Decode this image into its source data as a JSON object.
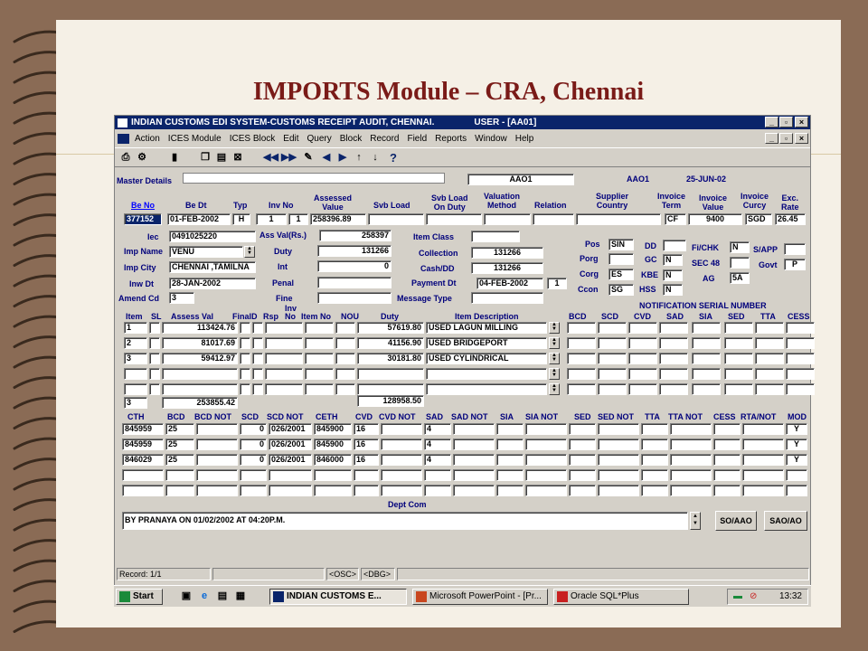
{
  "slide": {
    "title": "IMPORTS Module – CRA, Chennai"
  },
  "window": {
    "title": "INDIAN CUSTOMS EDI SYSTEM-CUSTOMS RECEIPT AUDIT, CHENNAI.",
    "user": "USER - [AA01]"
  },
  "menu": [
    "Action",
    "ICES Module",
    "ICES Block",
    "Edit",
    "Query",
    "Block",
    "Record",
    "Field",
    "Reports",
    "Window",
    "Help"
  ],
  "master": {
    "label": "Master Details",
    "user_code": "AAO1",
    "user_code2": "AAO1",
    "date": "25-JUN-02"
  },
  "hdr1": {
    "be_no": "Be No",
    "be_dt": "Be Dt",
    "typ": "Typ",
    "inv_no": "Inv No",
    "assessed_value": "Assessed\nValue",
    "svb_load": "Svb Load",
    "svb_load_on_duty": "Svb Load\nOn Duty",
    "valuation_method": "Valuation\nMethod",
    "relation": "Relation",
    "supplier_country": "Supplier\nCountry",
    "invoice_term": "Invoice\nTerm",
    "invoice_value": "Invoice\nValue",
    "invoice_curcy": "Invoice\nCurcy",
    "exc_rate": "Exc.\nRate"
  },
  "row1": {
    "be_no": "377152",
    "be_dt": "01-FEB-2002",
    "typ": "H",
    "inv_no_a": "1",
    "inv_no_b": "1",
    "assessed_value": "258396.89",
    "invoice_term": "CF",
    "invoice_value": "9400",
    "invoice_curcy": "SGD",
    "exc_rate": "26.45"
  },
  "left": {
    "iec_label": "Iec",
    "iec": "0491025220",
    "imp_name_label": "Imp Name",
    "imp_name": "VENU",
    "imp_city_label": "Imp City",
    "imp_city": "CHENNAI ,TAMILNA",
    "inw_dt_label": "Inw Dt",
    "inw_dt": "28-JAN-2002",
    "amend_cd_label": "Amend Cd",
    "amend_cd": "3"
  },
  "mid": {
    "ass_val_label": "Ass Val(Rs.)",
    "ass_val": "258397",
    "duty_label": "Duty",
    "duty": "131266",
    "int_label": "Int",
    "int": "0",
    "penal_label": "Penal",
    "fine_label": "Fine"
  },
  "coll": {
    "item_class_label": "Item Class",
    "collection_label": "Collection",
    "collection": "131266",
    "cash_dd_label": "Cash/DD",
    "cash_dd": "131266",
    "payment_dt_label": "Payment Dt",
    "payment_dt": "04-FEB-2002",
    "payment_no": "1",
    "message_type_label": "Message Type"
  },
  "ports": {
    "pos_label": "Pos",
    "pos": "SIN",
    "porg_label": "Porg",
    "corg_label": "Corg",
    "corg": "ES",
    "ccon_label": "Ccon",
    "ccon": "SG",
    "dd_label": "DD",
    "gc_label": "GC",
    "gc": "N",
    "kbe_label": "KBE",
    "kbe": "N",
    "hss_label": "HSS",
    "hss": "N",
    "fichk_label": "Fi/CHK",
    "fichk": "N",
    "sec48_label": "SEC 48",
    "ag_label": "AG",
    "ag": "5A",
    "sapp_label": "S/APP",
    "govt_label": "Govt",
    "govt": "P"
  },
  "notification_label": "NOTIFICATION SERIAL NUMBER",
  "items": {
    "headers": [
      "Item",
      "SL",
      "Assess Val",
      "FinalD",
      "Rsp",
      "Inv\nNo",
      "Item No",
      "NOU",
      "Duty",
      "Item Description",
      "BCD",
      "SCD",
      "CVD",
      "SAD",
      "SIA",
      "SED",
      "TTA",
      "CESS"
    ],
    "rows": [
      {
        "item": "1",
        "assess_val": "113424.76",
        "duty": "57619.80",
        "desc": "USED LAGUN MILLING"
      },
      {
        "item": "2",
        "assess_val": "81017.69",
        "duty": "41156.90",
        "desc": "USED BRIDGEPORT"
      },
      {
        "item": "3",
        "assess_val": "59412.97",
        "duty": "30181.80",
        "desc": "USED CYLINDRICAL"
      }
    ],
    "total_count": "3",
    "total_assess": "253855.42",
    "total_duty": "128958.50"
  },
  "tariff": {
    "headers": [
      "CTH",
      "BCD",
      "BCD NOT",
      "SCD",
      "SCD NOT",
      "CETH",
      "CVD",
      "CVD NOT",
      "SAD",
      "SAD NOT",
      "SIA",
      "SIA NOT",
      "SED",
      "SED NOT",
      "TTA",
      "TTA NOT",
      "CESS",
      "RTA/NOT",
      "MOD"
    ],
    "rows": [
      {
        "cth": "845959",
        "bcd": "25",
        "scd": "0",
        "scd_not": "026/2001",
        "ceth": "845900",
        "cvd": "16",
        "sad": "4",
        "mod": "Y"
      },
      {
        "cth": "845959",
        "bcd": "25",
        "scd": "0",
        "scd_not": "026/2001",
        "ceth": "845900",
        "cvd": "16",
        "sad": "4",
        "mod": "Y"
      },
      {
        "cth": "846029",
        "bcd": "25",
        "scd": "0",
        "scd_not": "026/2001",
        "ceth": "846000",
        "cvd": "16",
        "sad": "4",
        "mod": "Y"
      }
    ]
  },
  "dept": {
    "label": "Dept Com",
    "comment": "BY PRANAYA ON 01/02/2002 AT 04:20P.M.",
    "so_aao": "SO/AAO",
    "sao_ao": "SAO/AO"
  },
  "statusbar": {
    "record": "Record: 1/1",
    "osc": "<OSC>",
    "dbg": "<DBG>"
  },
  "taskbar": {
    "start": "Start",
    "task1": "INDIAN CUSTOMS E...",
    "task2": "Microsoft PowerPoint - [Pr...",
    "task3": "Oracle SQL*Plus",
    "time": "13:32"
  }
}
